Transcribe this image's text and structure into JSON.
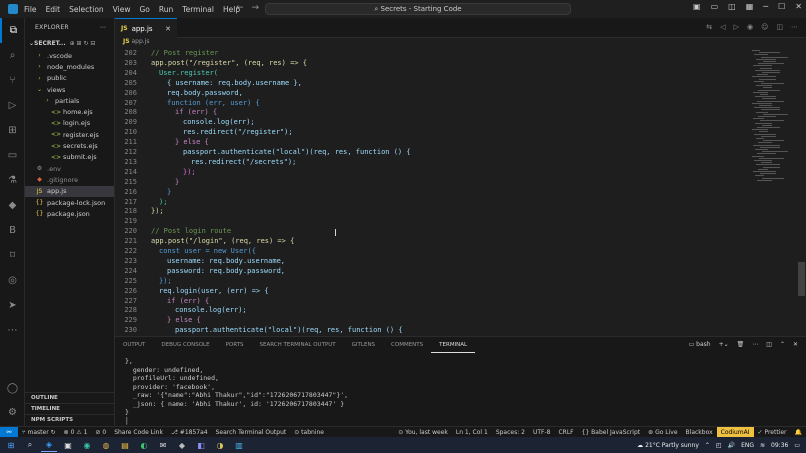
{
  "menu": [
    "File",
    "Edit",
    "Selection",
    "View",
    "Go",
    "Run",
    "Terminal",
    "Help"
  ],
  "command_center": "Secrets - Starting Code",
  "explorer": {
    "title": "EXPLORER",
    "project": "SECRET...",
    "items": [
      {
        "label": ".vscode",
        "kind": "folder",
        "indent": 1
      },
      {
        "label": "node_modules",
        "kind": "folder",
        "indent": 1
      },
      {
        "label": "public",
        "kind": "folder",
        "indent": 1
      },
      {
        "label": "views",
        "kind": "folder-open",
        "indent": 1
      },
      {
        "label": "partials",
        "kind": "folder",
        "indent": 2
      },
      {
        "label": "home.ejs",
        "kind": "ejs",
        "indent": 3
      },
      {
        "label": "login.ejs",
        "kind": "ejs",
        "indent": 3
      },
      {
        "label": "register.ejs",
        "kind": "ejs",
        "indent": 3
      },
      {
        "label": "secrets.ejs",
        "kind": "ejs",
        "indent": 3
      },
      {
        "label": "submit.ejs",
        "kind": "ejs",
        "indent": 3
      },
      {
        "label": ".env",
        "kind": "env",
        "indent": 1
      },
      {
        "label": ".gitignore",
        "kind": "git",
        "indent": 1
      },
      {
        "label": "app.js",
        "kind": "js",
        "indent": 1,
        "selected": true
      },
      {
        "label": "package-lock.json",
        "kind": "json",
        "indent": 1
      },
      {
        "label": "package.json",
        "kind": "json",
        "indent": 1
      }
    ],
    "bottom": [
      "OUTLINE",
      "TIMELINE",
      "NPM SCRIPTS"
    ]
  },
  "tab": {
    "icon": "JS",
    "label": "app.js"
  },
  "breadcrumb": {
    "icon": "JS",
    "label": "app.js"
  },
  "code": [
    {
      "n": "202",
      "indent": 1,
      "text": "// Post register",
      "color": "#6a9955"
    },
    {
      "n": "203",
      "indent": 1,
      "text": "app.post(\"/register\", (req, res) => {",
      "color": "#dcdcaa"
    },
    {
      "n": "204",
      "indent": 2,
      "text": "User.register(",
      "color": "#4ec9b0"
    },
    {
      "n": "205",
      "indent": 3,
      "text": "{ username: req.body.username },",
      "color": "#9cdcfe"
    },
    {
      "n": "206",
      "indent": 3,
      "text": "req.body.password,",
      "color": "#9cdcfe"
    },
    {
      "n": "207",
      "indent": 3,
      "text": "function (err, user) {",
      "color": "#569cd6"
    },
    {
      "n": "208",
      "indent": 4,
      "text": "if (err) {",
      "color": "#c586c0"
    },
    {
      "n": "209",
      "indent": 5,
      "text": "console.log(err);",
      "color": "#9cdcfe"
    },
    {
      "n": "210",
      "indent": 5,
      "text": "res.redirect(\"/register\");",
      "color": "#9cdcfe"
    },
    {
      "n": "211",
      "indent": 4,
      "text": "} else {",
      "color": "#c586c0"
    },
    {
      "n": "212",
      "indent": 5,
      "text": "passport.authenticate(\"local\")(req, res, function () {",
      "color": "#9cdcfe"
    },
    {
      "n": "213",
      "indent": 6,
      "text": "res.redirect(\"/secrets\");",
      "color": "#9cdcfe"
    },
    {
      "n": "214",
      "indent": 5,
      "text": "});",
      "color": "#da70d6"
    },
    {
      "n": "215",
      "indent": 4,
      "text": "}",
      "color": "#c586c0"
    },
    {
      "n": "216",
      "indent": 3,
      "text": "}",
      "color": "#569cd6"
    },
    {
      "n": "217",
      "indent": 2,
      "text": ");",
      "color": "#4ec9b0"
    },
    {
      "n": "218",
      "indent": 1,
      "text": "});",
      "color": "#dcdcaa"
    },
    {
      "n": "219",
      "indent": 1,
      "text": "",
      "color": "#d4d4d4"
    },
    {
      "n": "220",
      "indent": 1,
      "text": "// Post login route",
      "color": "#6a9955"
    },
    {
      "n": "221",
      "indent": 1,
      "text": "app.post(\"/login\", (req, res) => {",
      "color": "#dcdcaa"
    },
    {
      "n": "222",
      "indent": 2,
      "text": "const user = new User({",
      "color": "#569cd6"
    },
    {
      "n": "223",
      "indent": 3,
      "text": "username: req.body.username,",
      "color": "#9cdcfe"
    },
    {
      "n": "224",
      "indent": 3,
      "text": "password: req.body.password,",
      "color": "#9cdcfe"
    },
    {
      "n": "225",
      "indent": 2,
      "text": "});",
      "color": "#569cd6"
    },
    {
      "n": "226",
      "indent": 2,
      "text": "req.login(user, (err) => {",
      "color": "#9cdcfe"
    },
    {
      "n": "227",
      "indent": 3,
      "text": "if (err) {",
      "color": "#c586c0"
    },
    {
      "n": "228",
      "indent": 4,
      "text": "console.log(err);",
      "color": "#9cdcfe"
    },
    {
      "n": "229",
      "indent": 3,
      "text": "} else {",
      "color": "#c586c0"
    },
    {
      "n": "230",
      "indent": 4,
      "text": "passport.authenticate(\"local\")(req, res, function () {",
      "color": "#9cdcfe"
    }
  ],
  "panel": {
    "tabs": [
      "OUTPUT",
      "DEBUG CONSOLE",
      "PORTS",
      "SEARCH TERMINAL OUTPUT",
      "GITLENS",
      "COMMENTS",
      "TERMINAL"
    ],
    "active_tab": "TERMINAL",
    "shell": "bash",
    "terminal_lines": [
      "},",
      "  gender: undefined,",
      "  profileUrl: undefined,",
      "  provider: 'facebook',",
      "  _raw: '{\"name\":\"Abhi Thakur\",\"id\":\"1726206717803447\"}',",
      "  _json: { name: 'Abhi Thakur', id: '1726206717803447' }",
      "}",
      "│"
    ]
  },
  "status": {
    "branch": "master",
    "errors": "0",
    "warnings": "1",
    "ports": "0",
    "share": "Share Code Link",
    "commit": "#1857a4",
    "search": "Search Terminal Output",
    "tabnine": "tabnine",
    "blame": "You, last week",
    "position": "Ln 1, Col 1",
    "spaces": "Spaces: 2",
    "encoding": "UTF-8",
    "eol": "CRLF",
    "language": "Babel JavaScript",
    "golive": "Go Live",
    "blackbox": "Blackbox",
    "codium": "CodiumAI",
    "prettier": "Prettier"
  },
  "taskbar": {
    "weather": "21°C  Partly sunny",
    "lang": "ENG",
    "time": "09:36"
  },
  "colors": {
    "accent": "#0078d4",
    "background": "#1e1e1e",
    "sidebar": "#181818"
  }
}
